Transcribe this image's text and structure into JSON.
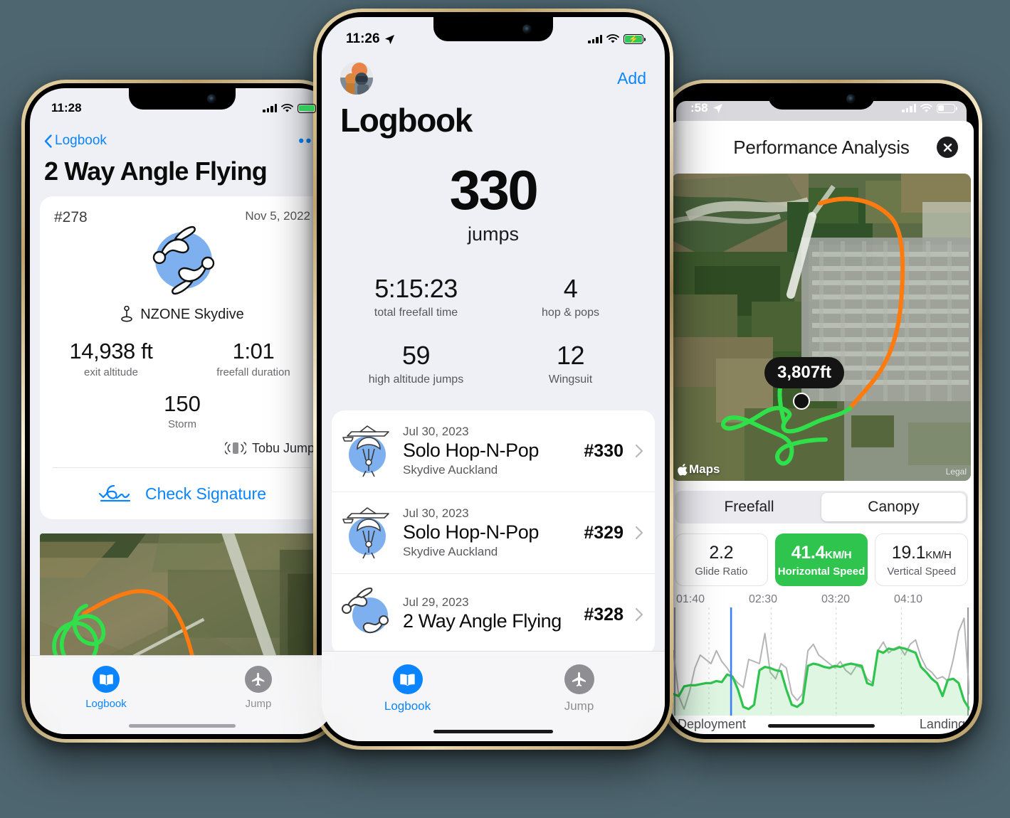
{
  "background_color": "#4e6670",
  "accent_blue": "#0a84ff",
  "accent_green": "#2fc44d",
  "track_orange": "#ff7a0f",
  "track_green": "#2fe04a",
  "phones": {
    "left": {
      "status_bar": {
        "time": "11:28",
        "location_icon": "location-arrow-icon",
        "signal": "cellular-bars-icon",
        "wifi": "wifi-icon",
        "battery": "battery-charging-icon"
      },
      "nav": {
        "back_label": "Logbook",
        "back_icon": "chevron-left-icon",
        "more_icon": "more-dots-icon"
      },
      "title": "2 Way Angle Flying",
      "jump": {
        "number": "#278",
        "date": "Nov 5, 2022",
        "discipline_icon": "two-way-angle-flying-icon",
        "dropzone": "NZONE Skydive",
        "dropzone_icon": "location-pin-icon",
        "stats": [
          {
            "value": "14,938 ft",
            "label": "exit altitude"
          },
          {
            "value": "1:01",
            "label": "freefall duration"
          },
          {
            "value": "150",
            "label": "Storm"
          }
        ],
        "device": {
          "label": "Tobu Jump",
          "icon": "device-signal-icon"
        },
        "signature": {
          "label": "Check Signature",
          "icon": "signature-icon"
        }
      },
      "tabbar": [
        {
          "label": "Logbook",
          "icon": "book-icon",
          "selected": true
        },
        {
          "label": "Jump",
          "icon": "airplane-icon",
          "selected": false
        }
      ]
    },
    "center": {
      "status_bar": {
        "time": "11:26",
        "location_icon": "location-arrow-icon",
        "signal": "cellular-bars-icon",
        "wifi": "wifi-icon",
        "battery": "battery-charging-icon"
      },
      "nav": {
        "avatar": "profile-avatar",
        "add_label": "Add"
      },
      "title": "Logbook",
      "summary": {
        "count": "330",
        "count_label": "jumps",
        "stats": [
          {
            "value": "5:15:23",
            "label": "total freefall time"
          },
          {
            "value": "4",
            "label": "hop & pops"
          },
          {
            "value": "59",
            "label": "high altitude jumps"
          },
          {
            "value": "12",
            "label": "Wingsuit"
          }
        ]
      },
      "jumps": [
        {
          "date": "Jul 30, 2023",
          "title": "Solo Hop-N-Pop",
          "dropzone": "Skydive Auckland",
          "number": "#330",
          "icon": "canopy-icon"
        },
        {
          "date": "Jul 30, 2023",
          "title": "Solo Hop-N-Pop",
          "dropzone": "Skydive Auckland",
          "number": "#329",
          "icon": "canopy-icon"
        },
        {
          "date": "Jul 29, 2023",
          "title": "2 Way Angle Flying",
          "dropzone": "",
          "number": "#328",
          "icon": "two-way-angle-flying-icon"
        }
      ],
      "tabbar": [
        {
          "label": "Logbook",
          "icon": "book-icon",
          "selected": true
        },
        {
          "label": "Jump",
          "icon": "airplane-icon",
          "selected": false
        }
      ]
    },
    "right": {
      "status_bar": {
        "time": ":58",
        "location_icon": "location-arrow-icon",
        "signal": "cellular-bars-icon",
        "wifi": "wifi-icon",
        "battery": "battery-low-icon"
      },
      "sheet_title": "Performance Analysis",
      "close_icon": "close-circle-icon",
      "map": {
        "attribution": "Maps",
        "attribution_icon": "apple-logo-icon",
        "legal": "Legal",
        "altitude_callout": "3,807ft",
        "freefall_track_color": "#ff7a0f",
        "canopy_track_color": "#2fe04a"
      },
      "segments": [
        {
          "label": "Freefall",
          "selected": false
        },
        {
          "label": "Canopy",
          "selected": true
        }
      ],
      "metrics": [
        {
          "value": "2.2",
          "unit": "",
          "label": "Glide Ratio",
          "active": false
        },
        {
          "value": "41.4",
          "unit": "KM/H",
          "label": "Horizontal Speed",
          "active": true
        },
        {
          "value": "19.1",
          "unit": "KM/H",
          "label": "Vertical Speed",
          "active": false
        }
      ],
      "chart_footer": {
        "left": "Deployment",
        "right": "Landing"
      }
    }
  },
  "chart_data": {
    "type": "line",
    "title": "Canopy performance over time",
    "xlabel": "",
    "ylabel": "",
    "x_tick_labels": [
      "01:40",
      "02:30",
      "03:20",
      "04:10"
    ],
    "grid": true,
    "legend_position": "none",
    "annotations": [
      "Deployment",
      "Landing"
    ],
    "cursor_time": "02:00",
    "series": [
      {
        "name": "Horizontal Speed",
        "color": "#2fc44d",
        "filled": true,
        "values": [
          20,
          18,
          27,
          28,
          28,
          29,
          30,
          30,
          32,
          31,
          38,
          36,
          24,
          8,
          6,
          10,
          42,
          45,
          44,
          42,
          41,
          24,
          10,
          8,
          12,
          46,
          48,
          47,
          45,
          44,
          46,
          45,
          47,
          48,
          47,
          46,
          30,
          28,
          60,
          58,
          62,
          61,
          63,
          62,
          60,
          58,
          45,
          40,
          34,
          30,
          18,
          33,
          34,
          30,
          14,
          6
        ]
      },
      {
        "name": "Vertical Speed",
        "color": "#b5b5b5",
        "filled": false,
        "values": [
          60,
          18,
          6,
          22,
          44,
          56,
          52,
          48,
          60,
          50,
          44,
          36,
          30,
          26,
          52,
          50,
          48,
          76,
          40,
          34,
          48,
          44,
          20,
          14,
          20,
          60,
          66,
          56,
          52,
          48,
          44,
          50,
          42,
          38,
          46,
          44,
          34,
          30,
          60,
          68,
          58,
          62,
          64,
          56,
          66,
          70,
          54,
          44,
          40,
          34,
          36,
          32,
          52,
          78,
          90,
          20
        ]
      }
    ]
  }
}
